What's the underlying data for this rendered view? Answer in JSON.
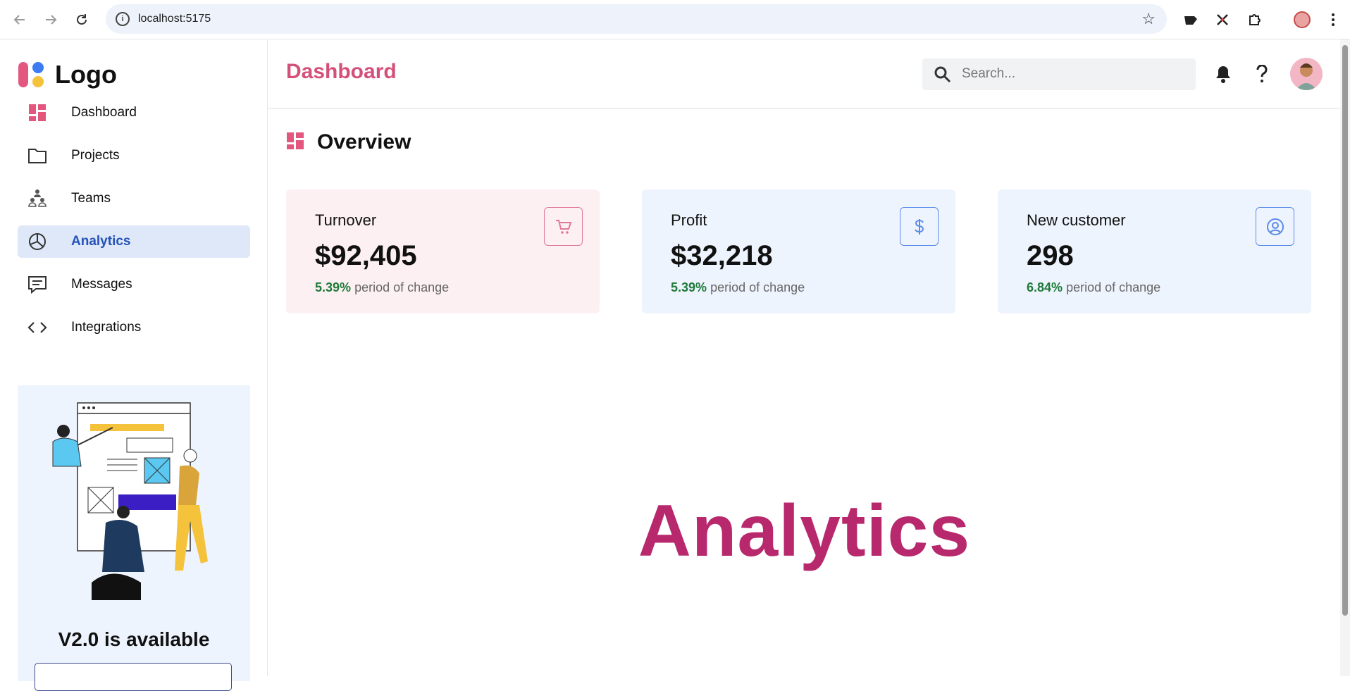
{
  "browser": {
    "url": "localhost:5175"
  },
  "sidebar": {
    "logo_text": "Logo",
    "items": [
      {
        "label": "Dashboard",
        "icon": "dashboard-icon"
      },
      {
        "label": "Projects",
        "icon": "folder-icon"
      },
      {
        "label": "Teams",
        "icon": "teams-icon"
      },
      {
        "label": "Analytics",
        "icon": "pie-chart-icon",
        "active": true
      },
      {
        "label": "Messages",
        "icon": "message-icon"
      },
      {
        "label": "Integrations",
        "icon": "code-icon"
      }
    ],
    "promo": {
      "title": "V2.0 is available"
    }
  },
  "header": {
    "title": "Dashboard",
    "search_placeholder": "Search..."
  },
  "main": {
    "section_title": "Overview",
    "cards": [
      {
        "title": "Turnover",
        "value": "$92,405",
        "change_pct": "5.39%",
        "change_text": "period of change",
        "icon": "cart-icon",
        "tone": "pink"
      },
      {
        "title": "Profit",
        "value": "$32,218",
        "change_pct": "5.39%",
        "change_text": "period of change",
        "icon": "dollar-icon",
        "tone": "blue"
      },
      {
        "title": "New customer",
        "value": "298",
        "change_pct": "6.84%",
        "change_text": "period of change",
        "icon": "user-circle-icon",
        "tone": "blue"
      }
    ],
    "page_heading": "Analytics"
  },
  "colors": {
    "accent_pink": "#d4507a",
    "heading_magenta": "#b8286d",
    "active_nav_bg": "#dfe8f8",
    "active_nav_text": "#2552b8",
    "positive_green": "#1f7a3a"
  }
}
